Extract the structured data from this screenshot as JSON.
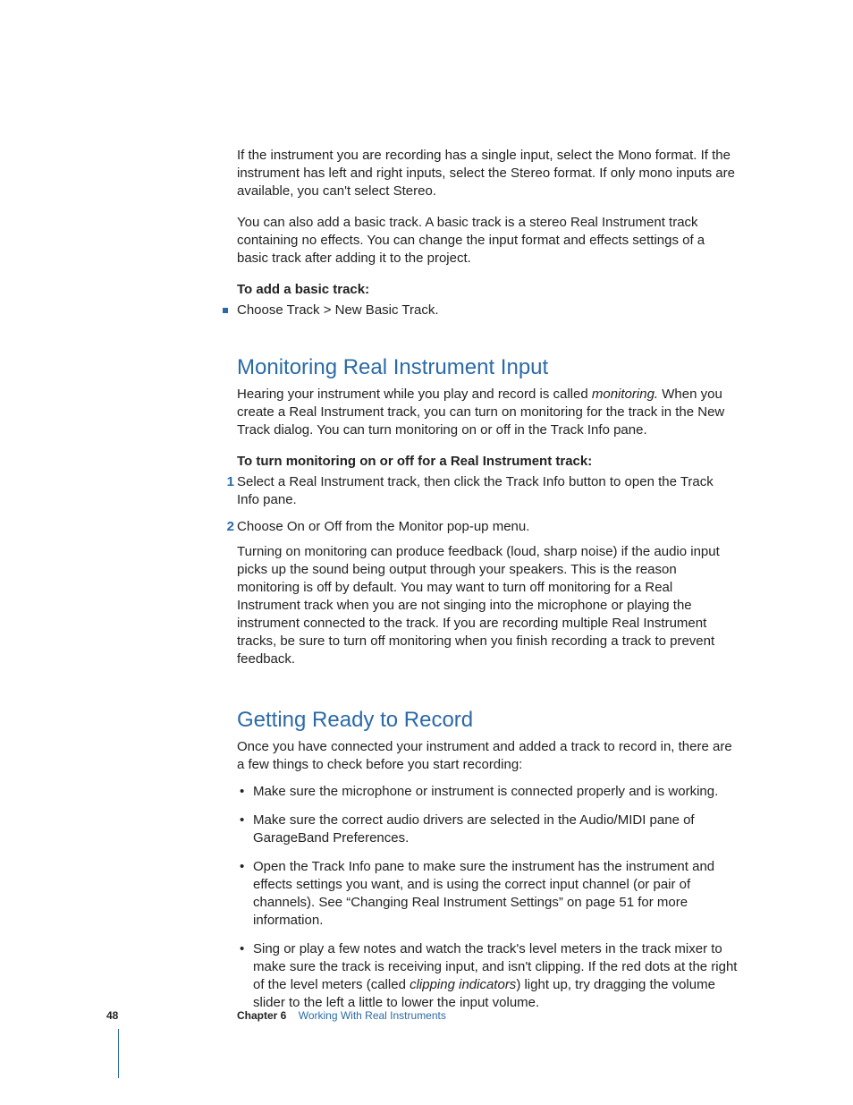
{
  "intro": {
    "p1": "If the instrument you are recording has a single input, select the Mono format. If the instrument has left and right inputs, select the Stereo format. If only mono inputs are available, you can't select Stereo.",
    "p2": "You can also add a basic track. A basic track is a stereo Real Instrument track containing no effects. You can change the input format and effects settings of a basic track after adding it to the project."
  },
  "basic_track": {
    "lead": "To add a basic track:",
    "step": "Choose Track > New Basic Track."
  },
  "monitoring": {
    "heading": "Monitoring Real Instrument Input",
    "p1a": "Hearing your instrument while you play and record is called ",
    "p1_em": "monitoring.",
    "p1b": " When you create a Real Instrument track, you can turn on monitoring for the track in the New Track dialog. You can turn monitoring on or off in the Track Info pane.",
    "lead": "To turn monitoring on or off for a Real Instrument track:",
    "step1": "Select a Real Instrument track, then click the Track Info button to open the Track Info pane.",
    "step2": "Choose On or Off from the Monitor pop-up menu.",
    "p2": "Turning on monitoring can produce feedback (loud, sharp noise) if the audio input picks up the sound being output through your speakers. This is the reason monitoring is off by default. You may want to turn off monitoring for a Real Instrument track when you are not singing into the microphone or playing the instrument connected to the track. If you are recording multiple Real Instrument tracks, be sure to turn off monitoring when you finish recording a track to prevent feedback."
  },
  "ready": {
    "heading": "Getting Ready to Record",
    "p1": "Once you have connected your instrument and added a track to record in, there are a few things to check before you start recording:",
    "b1": "Make sure the microphone or instrument is connected properly and is working.",
    "b2": "Make sure the correct audio drivers are selected in the Audio/MIDI pane of GarageBand Preferences.",
    "b3": "Open the Track Info pane to make sure the instrument has the instrument and effects settings you want, and is using the correct input channel (or pair of channels). See “Changing Real Instrument Settings” on page 51 for more information.",
    "b4a": "Sing or play a few notes and watch the track's level meters in the track mixer to make sure the track is receiving input, and isn't clipping. If the red dots at the right of the level meters (called ",
    "b4_em": "clipping indicators",
    "b4b": ") light up, try dragging the volume slider to the left a little to lower the input volume."
  },
  "footer": {
    "page": "48",
    "chapter_label": "Chapter 6",
    "chapter_title": "Working With Real Instruments"
  }
}
